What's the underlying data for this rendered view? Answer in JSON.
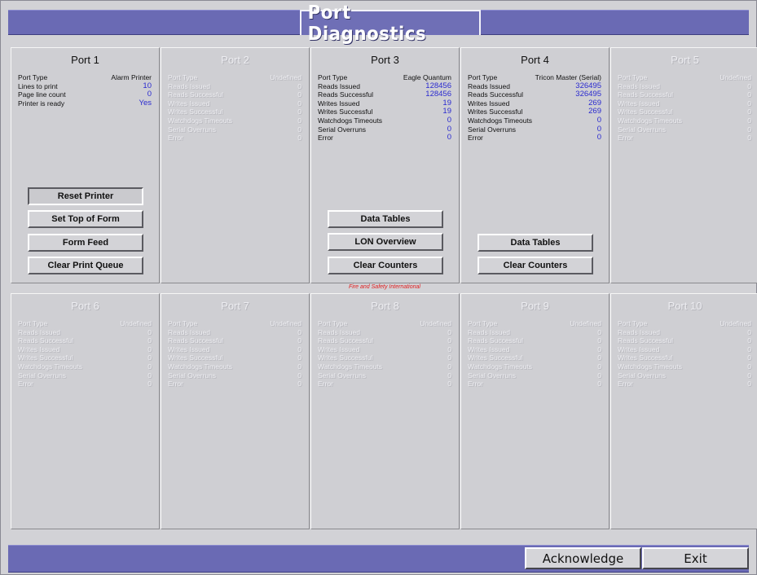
{
  "window": {
    "title": "Port Diagnostics"
  },
  "footer_credit": "Fire and Safety International",
  "footer": {
    "acknowledge_label": "Acknowledge",
    "exit_label": "Exit"
  },
  "colors": {
    "title_bar": "#6a6ab4",
    "value_blue": "#2a2ad0",
    "credit_red": "#e02020",
    "disabled_text": "#ededf1"
  },
  "ports": [
    {
      "title": "Port 1",
      "enabled": true,
      "rows": [
        {
          "label": "Port Type",
          "value": "Alarm Printer",
          "numeric": false
        },
        {
          "label": "Lines to print",
          "value": "10",
          "numeric": true
        },
        {
          "label": "Page line count",
          "value": "0",
          "numeric": true
        },
        {
          "label": "Printer is ready",
          "value": "Yes",
          "numeric": true
        }
      ],
      "buttons": [
        "Reset Printer",
        "Set Top of Form",
        "Form Feed",
        "Clear Print Queue"
      ],
      "pressed_button": 0
    },
    {
      "title": "Port 2",
      "enabled": false,
      "rows": [
        {
          "label": "Port Type",
          "value": "Undefined",
          "numeric": false
        },
        {
          "label": "Reads Issued",
          "value": "0",
          "numeric": true
        },
        {
          "label": "Reads Successful",
          "value": "0",
          "numeric": true
        },
        {
          "label": "Writes Issued",
          "value": "0",
          "numeric": true
        },
        {
          "label": "Writes Successful",
          "value": "0",
          "numeric": true
        },
        {
          "label": "Watchdogs Timeouts",
          "value": "0",
          "numeric": true
        },
        {
          "label": "Serial Overruns",
          "value": "0",
          "numeric": true
        },
        {
          "label": "Error",
          "value": "0",
          "numeric": true
        }
      ],
      "buttons": []
    },
    {
      "title": "Port 3",
      "enabled": true,
      "rows": [
        {
          "label": "Port Type",
          "value": "Eagle Quantum",
          "numeric": false
        },
        {
          "label": "Reads Issued",
          "value": "128456",
          "numeric": true
        },
        {
          "label": "Reads Successful",
          "value": "128456",
          "numeric": true
        },
        {
          "label": "Writes Issued",
          "value": "19",
          "numeric": true
        },
        {
          "label": "Writes Successful",
          "value": "19",
          "numeric": true
        },
        {
          "label": "Watchdogs Timeouts",
          "value": "0",
          "numeric": true
        },
        {
          "label": "Serial Overruns",
          "value": "0",
          "numeric": true
        },
        {
          "label": "Error",
          "value": "0",
          "numeric": true
        }
      ],
      "buttons": [
        "Data Tables",
        "LON Overview",
        "Clear Counters"
      ]
    },
    {
      "title": "Port 4",
      "enabled": true,
      "rows": [
        {
          "label": "Port Type",
          "value": "Tricon Master (Serial)",
          "numeric": false
        },
        {
          "label": "Reads Issued",
          "value": "326495",
          "numeric": true
        },
        {
          "label": "Reads Successful",
          "value": "326495",
          "numeric": true
        },
        {
          "label": "Writes Issued",
          "value": "269",
          "numeric": true
        },
        {
          "label": "Writes Successful",
          "value": "269",
          "numeric": true
        },
        {
          "label": "Watchdogs Timeouts",
          "value": "0",
          "numeric": true
        },
        {
          "label": "Serial Overruns",
          "value": "0",
          "numeric": true
        },
        {
          "label": "Error",
          "value": "0",
          "numeric": true
        }
      ],
      "buttons": [
        "Data Tables",
        "Clear Counters"
      ]
    },
    {
      "title": "Port 5",
      "enabled": false,
      "rows": [
        {
          "label": "Port Type",
          "value": "Undefined",
          "numeric": false
        },
        {
          "label": "Reads Issued",
          "value": "0",
          "numeric": true
        },
        {
          "label": "Reads Successful",
          "value": "0",
          "numeric": true
        },
        {
          "label": "Writes Issued",
          "value": "0",
          "numeric": true
        },
        {
          "label": "Writes Successful",
          "value": "0",
          "numeric": true
        },
        {
          "label": "Watchdogs Timeouts",
          "value": "0",
          "numeric": true
        },
        {
          "label": "Serial Overruns",
          "value": "0",
          "numeric": true
        },
        {
          "label": "Error",
          "value": "0",
          "numeric": true
        }
      ],
      "buttons": []
    },
    {
      "title": "Port 6",
      "enabled": false,
      "rows": [
        {
          "label": "Port Type",
          "value": "Undefined",
          "numeric": false
        },
        {
          "label": "Reads Issued",
          "value": "0",
          "numeric": true
        },
        {
          "label": "Reads Successful",
          "value": "0",
          "numeric": true
        },
        {
          "label": "Writes Issued",
          "value": "0",
          "numeric": true
        },
        {
          "label": "Writes Successful",
          "value": "0",
          "numeric": true
        },
        {
          "label": "Watchdogs Timeouts",
          "value": "0",
          "numeric": true
        },
        {
          "label": "Serial Overruns",
          "value": "0",
          "numeric": true
        },
        {
          "label": "Error",
          "value": "0",
          "numeric": true
        }
      ],
      "buttons": []
    },
    {
      "title": "Port 7",
      "enabled": false,
      "rows": [
        {
          "label": "Port Type",
          "value": "Undefined",
          "numeric": false
        },
        {
          "label": "Reads Issued",
          "value": "0",
          "numeric": true
        },
        {
          "label": "Reads Successful",
          "value": "0",
          "numeric": true
        },
        {
          "label": "Writes Issued",
          "value": "0",
          "numeric": true
        },
        {
          "label": "Writes Successful",
          "value": "0",
          "numeric": true
        },
        {
          "label": "Watchdogs Timeouts",
          "value": "0",
          "numeric": true
        },
        {
          "label": "Serial Overruns",
          "value": "0",
          "numeric": true
        },
        {
          "label": "Error",
          "value": "0",
          "numeric": true
        }
      ],
      "buttons": []
    },
    {
      "title": "Port 8",
      "enabled": false,
      "rows": [
        {
          "label": "Port Type",
          "value": "Undefined",
          "numeric": false
        },
        {
          "label": "Reads Issued",
          "value": "0",
          "numeric": true
        },
        {
          "label": "Reads Successful",
          "value": "0",
          "numeric": true
        },
        {
          "label": "Writes Issued",
          "value": "0",
          "numeric": true
        },
        {
          "label": "Writes Successful",
          "value": "0",
          "numeric": true
        },
        {
          "label": "Watchdogs Timeouts",
          "value": "0",
          "numeric": true
        },
        {
          "label": "Serial Overruns",
          "value": "0",
          "numeric": true
        },
        {
          "label": "Error",
          "value": "0",
          "numeric": true
        }
      ],
      "buttons": []
    },
    {
      "title": "Port 9",
      "enabled": false,
      "rows": [
        {
          "label": "Port Type",
          "value": "Undefined",
          "numeric": false
        },
        {
          "label": "Reads Issued",
          "value": "0",
          "numeric": true
        },
        {
          "label": "Reads Successful",
          "value": "0",
          "numeric": true
        },
        {
          "label": "Writes Issued",
          "value": "0",
          "numeric": true
        },
        {
          "label": "Writes Successful",
          "value": "0",
          "numeric": true
        },
        {
          "label": "Watchdogs Timeouts",
          "value": "0",
          "numeric": true
        },
        {
          "label": "Serial Overruns",
          "value": "0",
          "numeric": true
        },
        {
          "label": "Error",
          "value": "0",
          "numeric": true
        }
      ],
      "buttons": []
    },
    {
      "title": "Port 10",
      "enabled": false,
      "rows": [
        {
          "label": "Port Type",
          "value": "Undefined",
          "numeric": false
        },
        {
          "label": "Reads Issued",
          "value": "0",
          "numeric": true
        },
        {
          "label": "Reads Successful",
          "value": "0",
          "numeric": true
        },
        {
          "label": "Writes Issued",
          "value": "0",
          "numeric": true
        },
        {
          "label": "Writes Successful",
          "value": "0",
          "numeric": true
        },
        {
          "label": "Watchdogs Timeouts",
          "value": "0",
          "numeric": true
        },
        {
          "label": "Serial Overruns",
          "value": "0",
          "numeric": true
        },
        {
          "label": "Error",
          "value": "0",
          "numeric": true
        }
      ],
      "buttons": []
    }
  ]
}
